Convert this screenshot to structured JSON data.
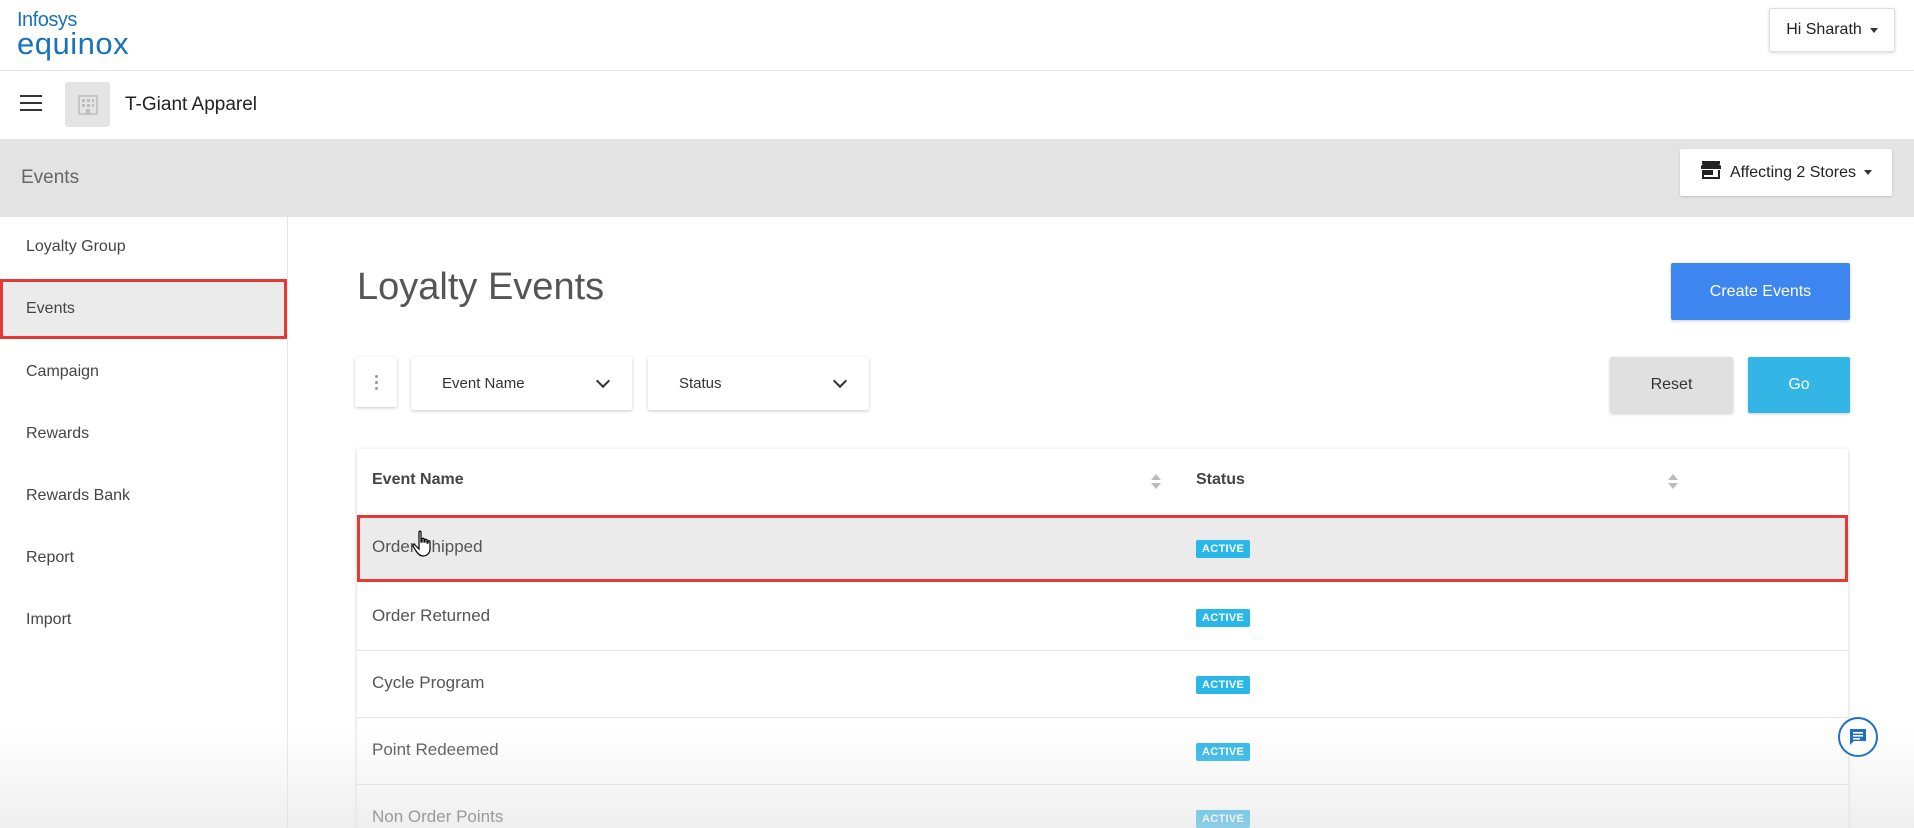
{
  "brand": {
    "line1": "Infosys",
    "line2": "equinox"
  },
  "user_menu": {
    "label": "Hi Sharath"
  },
  "org": {
    "name": "T-Giant Apparel"
  },
  "page_header": {
    "title": "Events",
    "stores_label": "Affecting 2 Stores"
  },
  "sidebar": {
    "items": [
      {
        "label": "Loyalty Group"
      },
      {
        "label": "Events"
      },
      {
        "label": "Campaign"
      },
      {
        "label": "Rewards"
      },
      {
        "label": "Rewards Bank"
      },
      {
        "label": "Report"
      },
      {
        "label": "Import"
      }
    ]
  },
  "main": {
    "title": "Loyalty Events",
    "create_label": "Create Events",
    "filters": {
      "event_name": "Event Name",
      "status": "Status"
    },
    "reset_label": "Reset",
    "go_label": "Go"
  },
  "table": {
    "columns": [
      "Event Name",
      "Status"
    ],
    "rows": [
      {
        "name": "Order Shipped",
        "status": "ACTIVE"
      },
      {
        "name": "Order Returned",
        "status": "ACTIVE"
      },
      {
        "name": "Cycle Program",
        "status": "ACTIVE"
      },
      {
        "name": "Point Redeemed",
        "status": "ACTIVE"
      },
      {
        "name": "Non Order Points",
        "status": "ACTIVE"
      }
    ]
  },
  "colors": {
    "primary_blue": "#3d86f0",
    "go_blue": "#33b5e5",
    "badge_blue": "#29b6e8",
    "highlight_red": "#e53935",
    "brand_blue": "#1a73b8"
  }
}
